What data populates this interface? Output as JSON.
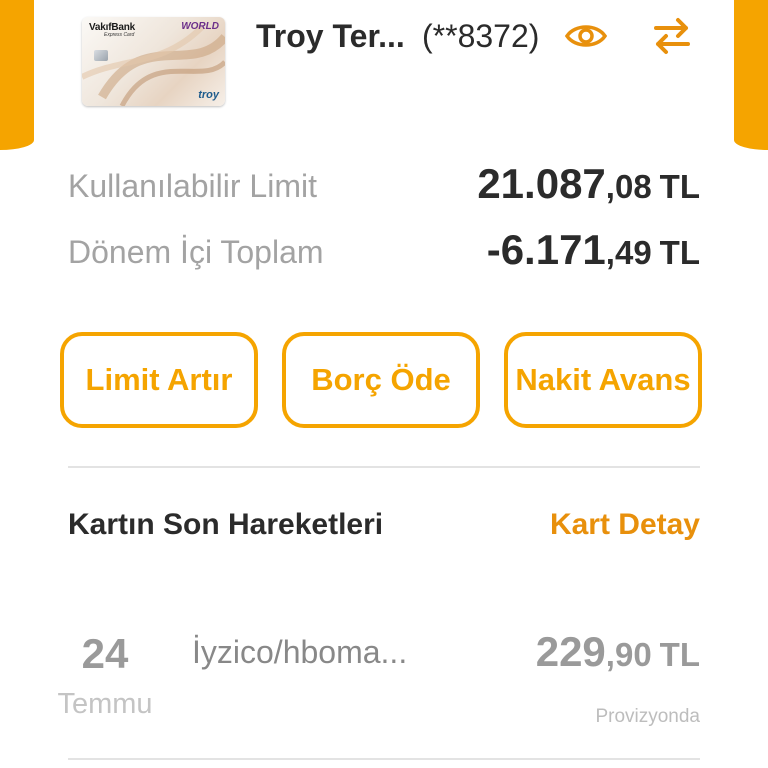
{
  "colors": {
    "accent": "#f5a400",
    "link": "#e8900c",
    "text_dark": "#2b2b2b",
    "text_muted": "#a3a3a3"
  },
  "card": {
    "thumbnail": {
      "bank": "VakıfBank",
      "product": "Express Card",
      "tier": "WORLD",
      "network": "troy"
    },
    "name": "Troy Ter...",
    "masked_number": "(**8372)",
    "eye_icon": "eye-icon",
    "swap_icon": "swap-arrows-icon"
  },
  "limits": [
    {
      "label": "Kullanılabilir Limit",
      "amount_int": "21.087",
      "amount_dec": ",08",
      "currency": "TL"
    },
    {
      "label": "Dönem İçi Toplam",
      "amount_int": "-6.171",
      "amount_dec": ",49",
      "currency": "TL"
    }
  ],
  "actions": [
    {
      "label": "Limit Artır"
    },
    {
      "label": "Borç Öde"
    },
    {
      "label": "Nakit Avans"
    }
  ],
  "recent": {
    "title": "Kartın Son Hareketleri",
    "detail_link": "Kart Detay",
    "transactions": [
      {
        "day": "24",
        "month": "Temmu",
        "merchant": "İyzico/hboma...",
        "amount_int": "229",
        "amount_dec": ",90",
        "currency": "TL",
        "status": "Provizyonda"
      }
    ]
  }
}
